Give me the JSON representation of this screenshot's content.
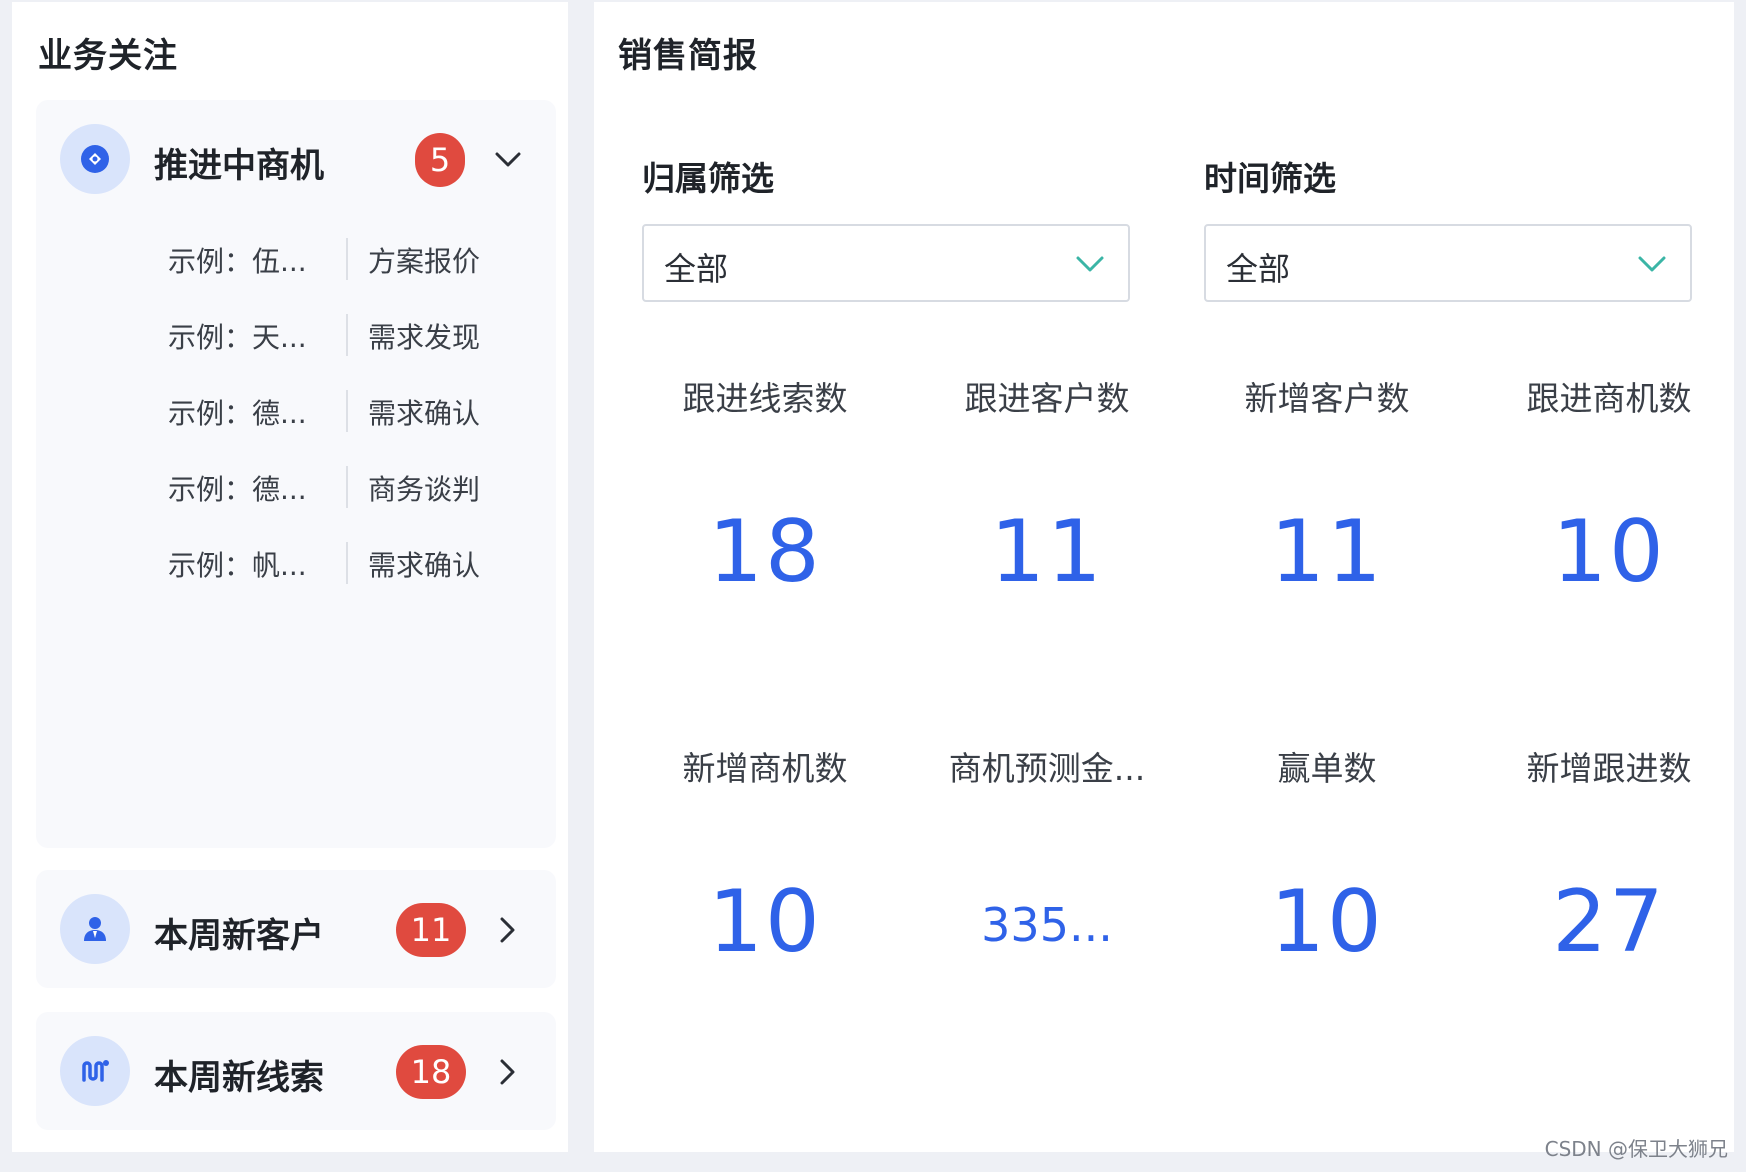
{
  "focus": {
    "title": "业务关注",
    "opportunities": {
      "label": "推进中商机",
      "count": "5",
      "items": [
        {
          "name": "示例：伍...",
          "stage": "方案报价"
        },
        {
          "name": "示例：天...",
          "stage": "需求发现"
        },
        {
          "name": "示例：德...",
          "stage": "需求确认"
        },
        {
          "name": "示例：德...",
          "stage": "商务谈判"
        },
        {
          "name": "示例：帆...",
          "stage": "需求确认"
        }
      ]
    },
    "new_customers": {
      "label": "本周新客户",
      "count": "11"
    },
    "new_leads": {
      "label": "本周新线索",
      "count": "18"
    }
  },
  "briefing": {
    "title": "销售简报",
    "filters": {
      "owner": {
        "label": "归属筛选",
        "value": "全部"
      },
      "time": {
        "label": "时间筛选",
        "value": "全部"
      }
    },
    "metrics": [
      {
        "label": "跟进线索数",
        "value": "18"
      },
      {
        "label": "跟进客户数",
        "value": "11"
      },
      {
        "label": "新增客户数",
        "value": "11"
      },
      {
        "label": "跟进商机数",
        "value": "10"
      },
      {
        "label": "新增商机数",
        "value": "10"
      },
      {
        "label": "商机预测金...",
        "value": "335..."
      },
      {
        "label": "赢单数",
        "value": "10"
      },
      {
        "label": "新增跟进数",
        "value": "27"
      }
    ]
  },
  "colors": {
    "accent": "#2f62e8",
    "badge": "#e04a3f",
    "icon_bg": "#d9e4fb",
    "select_arrow": "#3bb5a6"
  },
  "watermark": "CSDN @保卫大狮兄"
}
